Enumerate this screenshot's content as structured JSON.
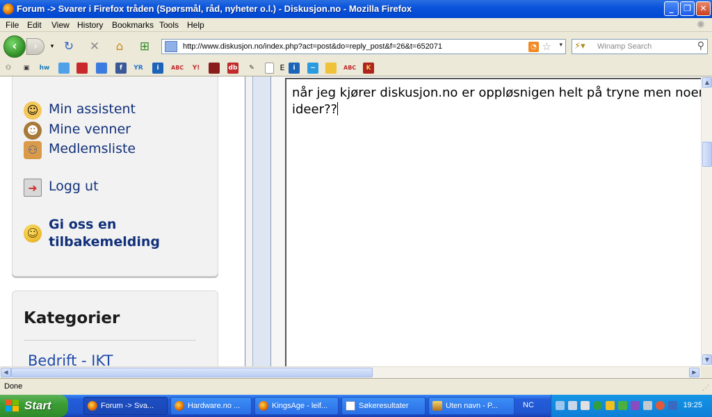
{
  "window": {
    "title": "Forum -> Svarer i Firefox tråden (Spørsmål, råd, nyheter o.l.) - Diskusjon.no - Mozilla Firefox",
    "minimize": "_",
    "maximize": "❐",
    "close": "✕"
  },
  "menu": {
    "file": "File",
    "edit": "Edit",
    "view": "View",
    "history": "History",
    "bookmarks": "Bookmarks",
    "tools": "Tools",
    "help": "Help"
  },
  "nav": {
    "url": "http://www.diskusjon.no/index.php?act=post&do=reply_post&f=26&t=652071",
    "search_placeholder": "Winamp Search"
  },
  "bookmarks_toolbar": [
    "hw",
    "YR",
    "ABC",
    "Y!",
    "db",
    "E",
    "ABC",
    "K"
  ],
  "sidebar": {
    "items": [
      {
        "label": "Min assistent",
        "icon": "assistant-face-icon"
      },
      {
        "label": "Mine venner",
        "icon": "monkey-face-icon"
      },
      {
        "label": "Medlemsliste",
        "icon": "members-icon"
      },
      {
        "label": "Logg ut",
        "icon": "logout-icon"
      }
    ],
    "feedback": "Gi oss en tilbakemelding"
  },
  "categories": {
    "title": "Kategorier",
    "first_item": "Bedrift - IKT"
  },
  "editor": {
    "text": "når jeg kjører diskusjon.no er oppløsnigen helt på tryne men noen ideer??"
  },
  "status": {
    "text": "Done"
  },
  "taskbar": {
    "start": "Start",
    "tasks": [
      {
        "label": "Forum -> Sva...",
        "active": true,
        "icon": "firefox"
      },
      {
        "label": "Hardware.no ...",
        "active": false,
        "icon": "firefox"
      },
      {
        "label": "KingsAge - leif...",
        "active": false,
        "icon": "firefox"
      },
      {
        "label": "Søkeresultater",
        "active": false,
        "icon": "doc"
      },
      {
        "label": "Uten navn - P...",
        "active": false,
        "icon": "paint"
      }
    ],
    "language": "NC",
    "clock": "19:25"
  }
}
